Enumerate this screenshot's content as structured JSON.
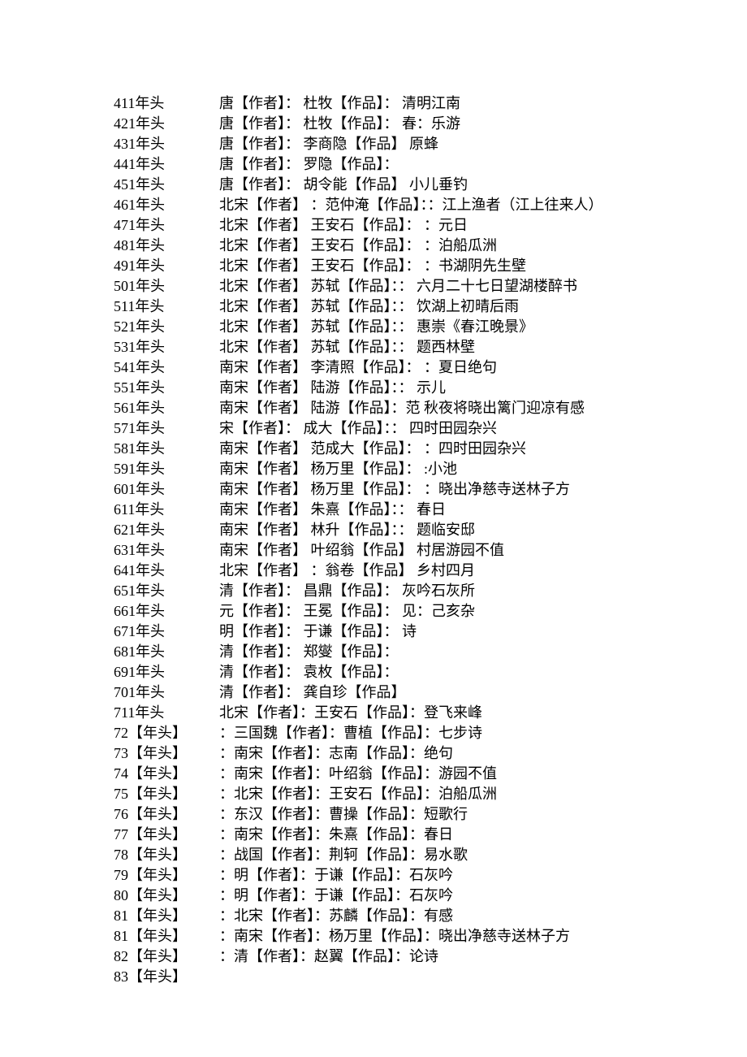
{
  "rows": [
    {
      "left": "411年头",
      "right": "唐【作者】：   杜牧【作品】：   清明江南"
    },
    {
      "left": "421年头",
      "right": "唐【作者】：   杜牧【作品】：   春：乐游"
    },
    {
      "left": "431年头",
      "right": "唐【作者】：   李商隐【作品】   原蜂"
    },
    {
      "left": "441年头",
      "right": "唐【作者】：   罗隐【作品】："
    },
    {
      "left": "451年头",
      "right": "唐【作者】：   胡令能【作品】     小儿垂钓"
    },
    {
      "left": "461年头",
      "right": "北宋【作者】  ：范仲淹【作品】：：江上渔者（江上往来人）"
    },
    {
      "left": "471年头",
      "right": "北宋【作者】   王安石【作品】：   ：元日"
    },
    {
      "left": "481年头",
      "right": "北宋【作者】   王安石【作品】：   ：泊船瓜洲"
    },
    {
      "left": "491年头",
      "right": "北宋【作者】   王安石【作品】：   ：书湖阴先生壁"
    },
    {
      "left": "501年头",
      "right": "北宋【作者】   苏轼【作品】：：   六月二十七日望湖楼醉书"
    },
    {
      "left": "511年头",
      "right": "北宋【作者】   苏轼【作品】：：   饮湖上初晴后雨"
    },
    {
      "left": "521年头",
      "right": "北宋【作者】   苏轼【作品】：：   惠崇《春江晚景》"
    },
    {
      "left": "531年头",
      "right": "北宋【作者】   苏轼【作品】：：   题西林壁"
    },
    {
      "left": "541年头",
      "right": "南宋【作者】   李清照【作品】：   ：夏日绝句"
    },
    {
      "left": "551年头",
      "right": "南宋【作者】   陆游【作品】：：   示儿"
    },
    {
      "left": "561年头",
      "right": "南宋【作者】   陆游【作品】：范   秋夜将晓出篱门迎凉有感"
    },
    {
      "left": "571年头",
      "right": "宋【作者】：   成大【作品】：：   四时田园杂兴"
    },
    {
      "left": "581年头",
      "right": "南宋【作者】   范成大【作品】：   ：四时田园杂兴"
    },
    {
      "left": "591年头",
      "right": "南宋【作者】   杨万里【作品】：   :小池"
    },
    {
      "left": "601年头",
      "right": "南宋【作者】   杨万里【作品】：   ：晓出净慈寺送林子方"
    },
    {
      "left": "611年头",
      "right": "南宋【作者】   朱熹【作品】：：   春日"
    },
    {
      "left": "621年头",
      "right": "南宋【作者】   林升【作品】：：   题临安邸"
    },
    {
      "left": "631年头",
      "right": "南宋【作者】   叶绍翁【作品】     村居游园不值"
    },
    {
      "left": "641年头",
      "right": "北宋【作者】   ：翁卷【作品】     乡村四月"
    },
    {
      "left": "651年头",
      "right": "清【作者】：   昌鼎【作品】：   灰吟石灰所"
    },
    {
      "left": "661年头",
      "right": "元【作者】：   王冕【作品】：   见：己亥杂"
    },
    {
      "left": "671年头",
      "right": "明【作者】：   于谦【作品】：   诗"
    },
    {
      "left": "681年头",
      "right": "清【作者】：   郑燮【作品】："
    },
    {
      "left": "691年头",
      "right": "清【作者】：   袁枚【作品】："
    },
    {
      "left": "701年头",
      "right": "清【作者】：   龚自珍【作品】"
    },
    {
      "left": "711年头",
      "right": "               北宋【作者】：王安石【作品】：登飞来峰"
    },
    {
      "left": "72【年头】",
      "right": "：三国魏【作者】：曹植【作品】：七步诗"
    },
    {
      "left": "73【年头】",
      "right": "：南宋【作者】：志南【作品】：绝句"
    },
    {
      "left": "74【年头】",
      "right": "：南宋【作者】：叶绍翁【作品】：游园不值"
    },
    {
      "left": "75【年头】",
      "right": "：北宋【作者】：王安石【作品】：泊船瓜洲"
    },
    {
      "left": "76【年头】",
      "right": "：东汉【作者】：曹操【作品】：短歌行"
    },
    {
      "left": "77【年头】",
      "right": "：南宋【作者】：朱熹【作品】：春日"
    },
    {
      "left": "78【年头】",
      "right": "：战国【作者】：荆轲【作品】：易水歌"
    },
    {
      "left": "79【年头】",
      "right": "：明【作者】：于谦【作品】：石灰吟"
    },
    {
      "left": "80【年头】",
      "right": "：明【作者】：于谦【作品】：石灰吟"
    },
    {
      "left": "81【年头】",
      "right": "：北宋【作者】：苏麟【作品】：有感"
    },
    {
      "left": "81【年头】",
      "right": "：南宋【作者】：杨万里【作品】：晓出净慈寺送林子方"
    },
    {
      "left": "82【年头】",
      "right": "：清【作者】：赵翼【作品】：论诗"
    },
    {
      "left": "83【年头】",
      "right": ""
    }
  ]
}
